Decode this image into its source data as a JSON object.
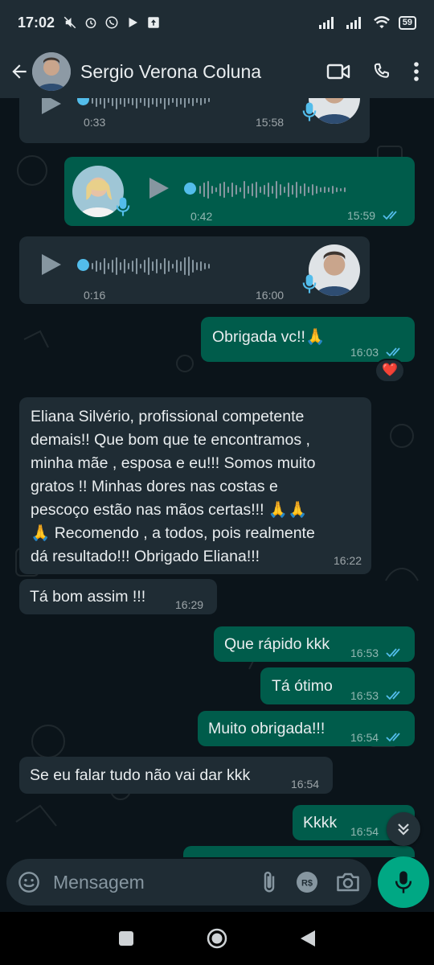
{
  "status_bar": {
    "time": "17:02",
    "battery": "59"
  },
  "header": {
    "contact_name": "Sergio Verona Coluna"
  },
  "audio_messages": [
    {
      "duration": "0:33",
      "time": "15:58",
      "direction": "in"
    },
    {
      "duration": "0:42",
      "time": "15:59",
      "direction": "out"
    },
    {
      "duration": "0:16",
      "time": "16:00",
      "direction": "in"
    }
  ],
  "messages": [
    {
      "text": "Obrigada vc!!🙏",
      "time": "16:03",
      "direction": "out",
      "reaction": "❤️"
    },
    {
      "text_lines": [
        "Eliana Silvério, profissional competente",
        "demais!! Que bom que te encontramos ,",
        "minha mãe , esposa e eu!!!  Somos muito",
        "gratos !! Minhas dores nas costas e",
        "pescoço estão nas mãos certas!!! 🙏🙏",
        "🙏 Recomendo , a todos, pois  realmente",
        "dá resultado!!! Obrigado Eliana!!!"
      ],
      "time": "16:22",
      "direction": "in"
    },
    {
      "text": "Tá bom assim !!!",
      "time": "16:29",
      "direction": "in"
    },
    {
      "text": "Que rápido kkk",
      "time": "16:53",
      "direction": "out"
    },
    {
      "text": "Tá ótimo",
      "time": "16:53",
      "direction": "out"
    },
    {
      "text": "Muito obrigada!!!",
      "time": "16:54",
      "direction": "out"
    },
    {
      "text": "Se eu falar tudo não vai dar kkk",
      "time": "16:54",
      "direction": "in"
    },
    {
      "text": "Kkkk",
      "time": "16:54",
      "direction": "out"
    }
  ],
  "composer": {
    "placeholder": "Mensagem"
  },
  "colors": {
    "incoming": "#1f2c34",
    "outgoing": "#005c4b",
    "accent": "#00a884",
    "read_ticks": "#53bdeb"
  }
}
